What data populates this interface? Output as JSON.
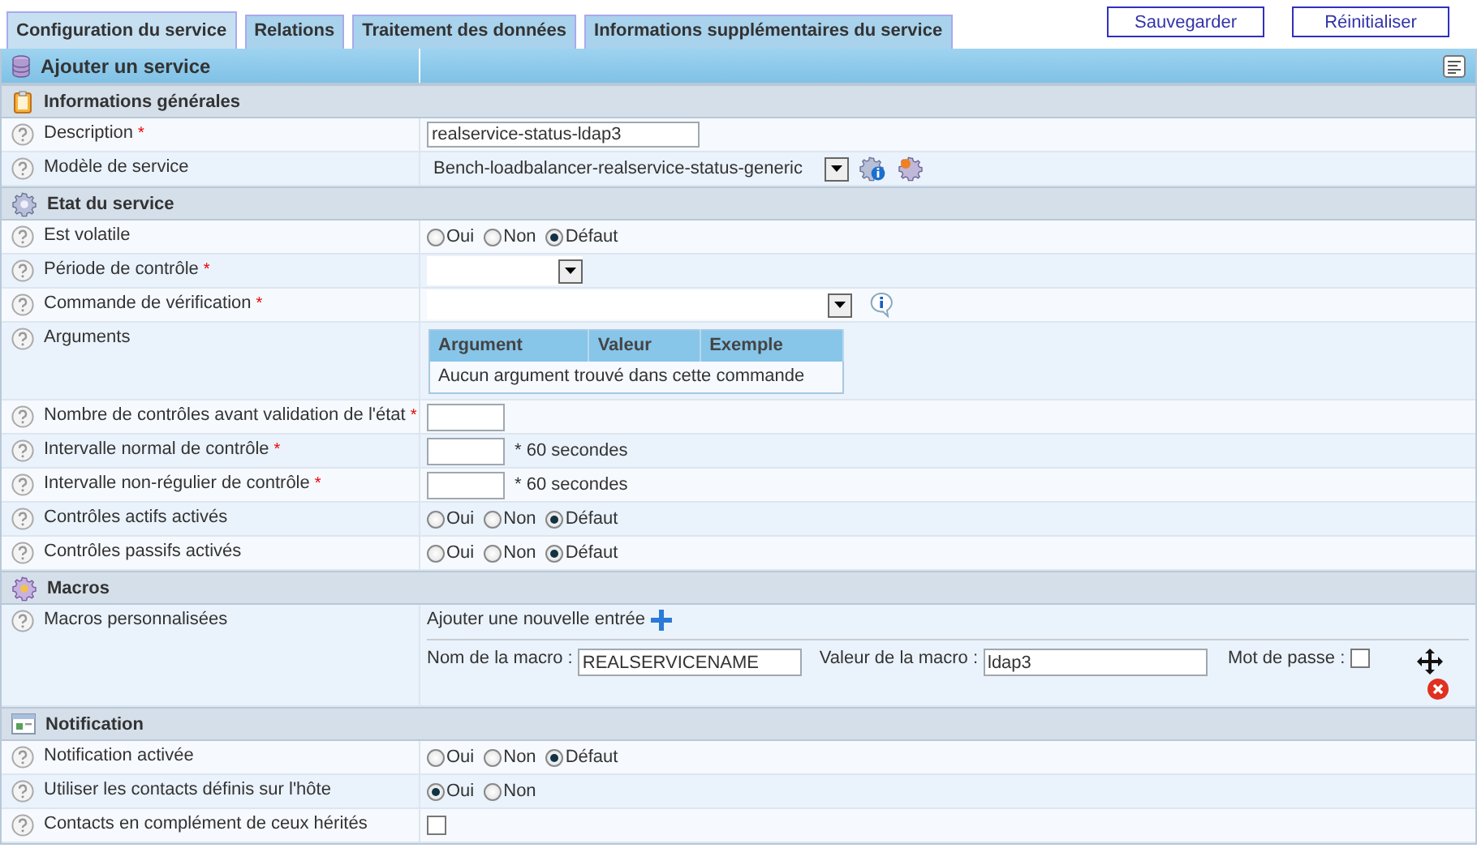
{
  "tabs": [
    {
      "label": "Configuration du service",
      "selected": true
    },
    {
      "label": "Relations",
      "selected": false
    },
    {
      "label": "Traitement des données",
      "selected": false
    },
    {
      "label": "Informations supplémentaires du service",
      "selected": false
    }
  ],
  "buttons": [
    "Sauvegarder",
    "Réinitialiser"
  ],
  "form_title": "Ajouter un service",
  "sections": [
    {
      "title": "Informations générales",
      "rows": [
        {
          "kind": "text",
          "label": "Description",
          "required_mark": "*",
          "value": "realservice-status-ldap3"
        },
        {
          "kind": "template-select",
          "label": "Modèle de service",
          "value": "Bench-loadbalancer-realservice-status-generic"
        }
      ]
    },
    {
      "title": "Etat du service",
      "rows": [
        {
          "kind": "radio",
          "label": "Est volatile",
          "options": [
            {
              "label": "Oui",
              "selected": false
            },
            {
              "label": "Non",
              "selected": false
            },
            {
              "label": "Défaut",
              "selected": true
            }
          ]
        },
        {
          "kind": "period-select",
          "label": "Période de contrôle",
          "required_mark": "*"
        },
        {
          "kind": "command-select",
          "label": "Commande de vérification",
          "required_mark": "*"
        },
        {
          "kind": "arguments",
          "label": "Arguments",
          "columns": [
            "Argument",
            "Valeur",
            "Exemple"
          ],
          "empty_text": "Aucun argument trouvé dans cette commande"
        },
        {
          "kind": "number",
          "label": "Nombre de contrôles avant validation de l'état",
          "required_mark": "*"
        },
        {
          "kind": "number",
          "label": "Intervalle normal de contrôle",
          "required_mark": "*",
          "suffix": "* 60 secondes"
        },
        {
          "kind": "number",
          "label": "Intervalle non-régulier de contrôle",
          "required_mark": "*",
          "suffix": "* 60 secondes"
        },
        {
          "kind": "radio",
          "label": "Contrôles actifs activés",
          "options": [
            {
              "label": "Oui",
              "selected": false
            },
            {
              "label": "Non",
              "selected": false
            },
            {
              "label": "Défaut",
              "selected": true
            }
          ]
        },
        {
          "kind": "radio",
          "label": "Contrôles passifs activés",
          "options": [
            {
              "label": "Oui",
              "selected": false
            },
            {
              "label": "Non",
              "selected": false
            },
            {
              "label": "Défaut",
              "selected": true
            }
          ]
        }
      ]
    },
    {
      "title": "Macros",
      "rows": [
        {
          "kind": "macros",
          "label": "Macros personnalisées",
          "add_label": "Ajouter une nouvelle entrée",
          "entries": [
            {
              "name_label": "Nom de la macro :",
              "name": "REALSERVICENAME",
              "value_label": "Valeur de la macro :",
              "value": "ldap3",
              "password_label": "Mot de passe :",
              "password": false
            }
          ]
        }
      ]
    },
    {
      "title": "Notification",
      "rows": [
        {
          "kind": "radio",
          "label": "Notification activée",
          "options": [
            {
              "label": "Oui",
              "selected": false
            },
            {
              "label": "Non",
              "selected": false
            },
            {
              "label": "Défaut",
              "selected": true
            }
          ]
        },
        {
          "kind": "radio",
          "label": "Utiliser les contacts définis sur l'hôte",
          "options": [
            {
              "label": "Oui",
              "selected": true
            },
            {
              "label": "Non",
              "selected": false
            }
          ]
        },
        {
          "kind": "checkbox",
          "label": "Contacts en complément de ceux hérités",
          "checked": false
        }
      ]
    }
  ]
}
